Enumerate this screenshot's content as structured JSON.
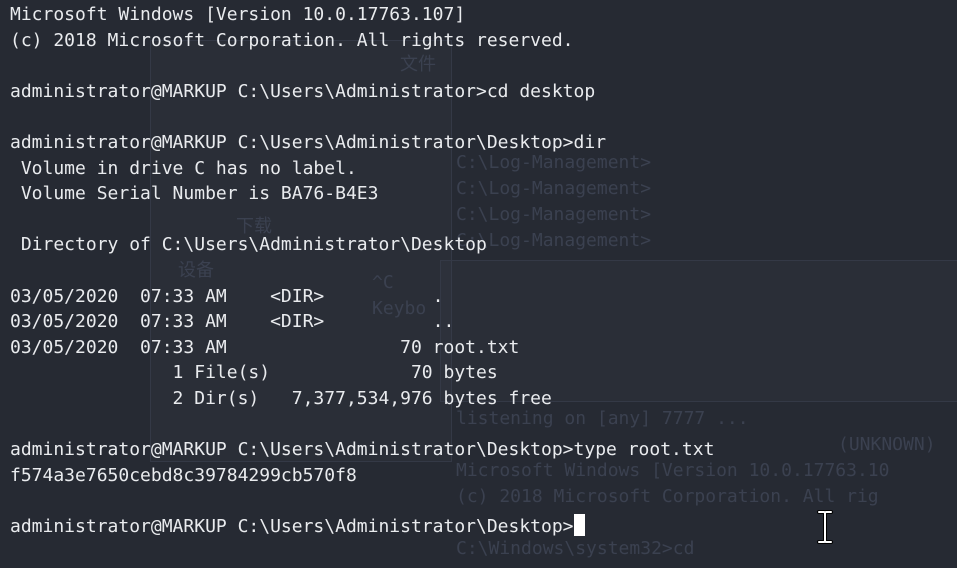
{
  "terminal": {
    "lines": [
      "Microsoft Windows [Version 10.0.17763.107]",
      "(c) 2018 Microsoft Corporation. All rights reserved.",
      "",
      "administrator@MARKUP C:\\Users\\Administrator>cd desktop",
      "",
      "administrator@MARKUP C:\\Users\\Administrator\\Desktop>dir",
      " Volume in drive C has no label.",
      " Volume Serial Number is BA76-B4E3",
      "",
      " Directory of C:\\Users\\Administrator\\Desktop",
      "",
      "03/05/2020  07:33 AM    <DIR>          .",
      "03/05/2020  07:33 AM    <DIR>          ..",
      "03/05/2020  07:33 AM                70 root.txt",
      "               1 File(s)             70 bytes",
      "               2 Dir(s)   7,377,534,976 bytes free",
      "",
      "administrator@MARKUP C:\\Users\\Administrator\\Desktop>type root.txt",
      "f574a3e7650cebd8c39784299cb570f8",
      "",
      "administrator@MARKUP C:\\Users\\Administrator\\Desktop>"
    ]
  },
  "background": {
    "ghost_lines": [
      "文件",
      "C:\\Log-Management>",
      "C:\\Log-Management>",
      "C:\\Log-Management>",
      "C:\\Log-Management>",
      "下载",
      "设备",
      "^C",
      "Keybo",
      "listening on [any] 7777 ...",
      "(UNKNOWN)",
      "Microsoft Windows [Version 10.0.17763.10",
      "(c) 2018 Microsoft Corporation. All rig",
      "C:\\Windows\\system32>cd"
    ]
  },
  "colors": {
    "background": "#262a33",
    "foreground": "#e9ebee",
    "cursor": "#ffffff"
  },
  "icons": {
    "text_cursor": "ibeam-cursor-icon"
  }
}
